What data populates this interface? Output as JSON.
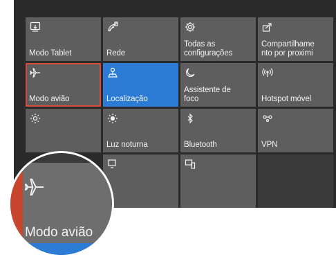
{
  "tiles": [
    {
      "label": "Modo Tablet",
      "icon": "tablet-icon",
      "state": "normal"
    },
    {
      "label": "Rede",
      "icon": "network-icon",
      "state": "normal"
    },
    {
      "label": "Todas as\nconfigurações",
      "icon": "gear-icon",
      "state": "normal"
    },
    {
      "label": "Compartilhame\nnto por proximi",
      "icon": "share-icon",
      "state": "normal"
    },
    {
      "label": "Modo avião",
      "icon": "airplane-icon",
      "state": "selected"
    },
    {
      "label": "Localização",
      "icon": "location-icon",
      "state": "active"
    },
    {
      "label": "Assistente de\nfoco",
      "icon": "moon-icon",
      "state": "normal"
    },
    {
      "label": "Hotspot móvel",
      "icon": "hotspot-icon",
      "state": "normal"
    },
    {
      "label": "",
      "icon": "brightness-icon",
      "state": "normal"
    },
    {
      "label": "Luz noturna",
      "icon": "night-light-icon",
      "state": "normal"
    },
    {
      "label": "Bluetooth",
      "icon": "bluetooth-icon",
      "state": "normal"
    },
    {
      "label": "VPN",
      "icon": "vpn-icon",
      "state": "normal"
    },
    {
      "label": "",
      "icon": "project-icon",
      "state": "normal"
    },
    {
      "label": "",
      "icon": "connect-icon",
      "state": "normal"
    }
  ],
  "magnifier": {
    "label": "Modo avião",
    "icon": "airplane-icon"
  },
  "colors": {
    "panel": "#2a2a2b",
    "tile": "#5e5e5f",
    "active": "#2c7cd6",
    "selected_border": "#d94b3a"
  }
}
